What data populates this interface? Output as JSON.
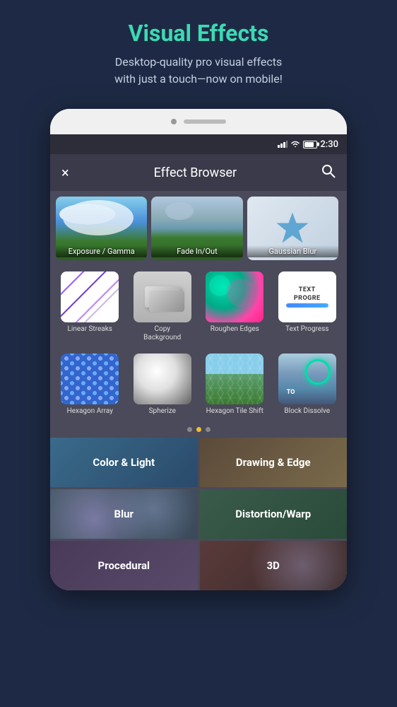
{
  "header": {
    "title": "Visual Effects",
    "subtitle": "Desktop-quality pro visual effects\nwith just a touch—now on mobile!"
  },
  "status_bar": {
    "time": "2:30"
  },
  "app_bar": {
    "title": "Effect Browser",
    "close_label": "×",
    "search_label": "🔍"
  },
  "featured_effects": [
    {
      "label": "Exposure / Gamma",
      "thumb": "exposure"
    },
    {
      "label": "Fade In/Out",
      "thumb": "fade"
    },
    {
      "label": "Gaussian Blur",
      "thumb": "gaussian"
    }
  ],
  "effects_row1": [
    {
      "label": "Linear Streaks",
      "thumb": "linear-streaks"
    },
    {
      "label": "Copy Background",
      "thumb": "copy-bg"
    },
    {
      "label": "Roughen Edges",
      "thumb": "roughen"
    },
    {
      "label": "Text Progress",
      "thumb": "text-progress"
    }
  ],
  "effects_row2": [
    {
      "label": "Hexagon Array",
      "thumb": "hexagon-array"
    },
    {
      "label": "Spherize",
      "thumb": "spherize"
    },
    {
      "label": "Hexagon Tile Shift",
      "thumb": "hexagon-tile"
    },
    {
      "label": "Block Dissolve",
      "thumb": "block-dissolve"
    }
  ],
  "pagination": {
    "dots": [
      {
        "active": false
      },
      {
        "active": true
      },
      {
        "active": false
      }
    ]
  },
  "categories": [
    {
      "label": "Color & Light",
      "style": "color-light"
    },
    {
      "label": "Drawing & Edge",
      "style": "drawing"
    },
    {
      "label": "Blur",
      "style": "blur"
    },
    {
      "label": "Distortion/Warp",
      "style": "distortion"
    },
    {
      "label": "Procedural",
      "style": "procedural"
    },
    {
      "label": "3D",
      "style": "3d"
    }
  ]
}
